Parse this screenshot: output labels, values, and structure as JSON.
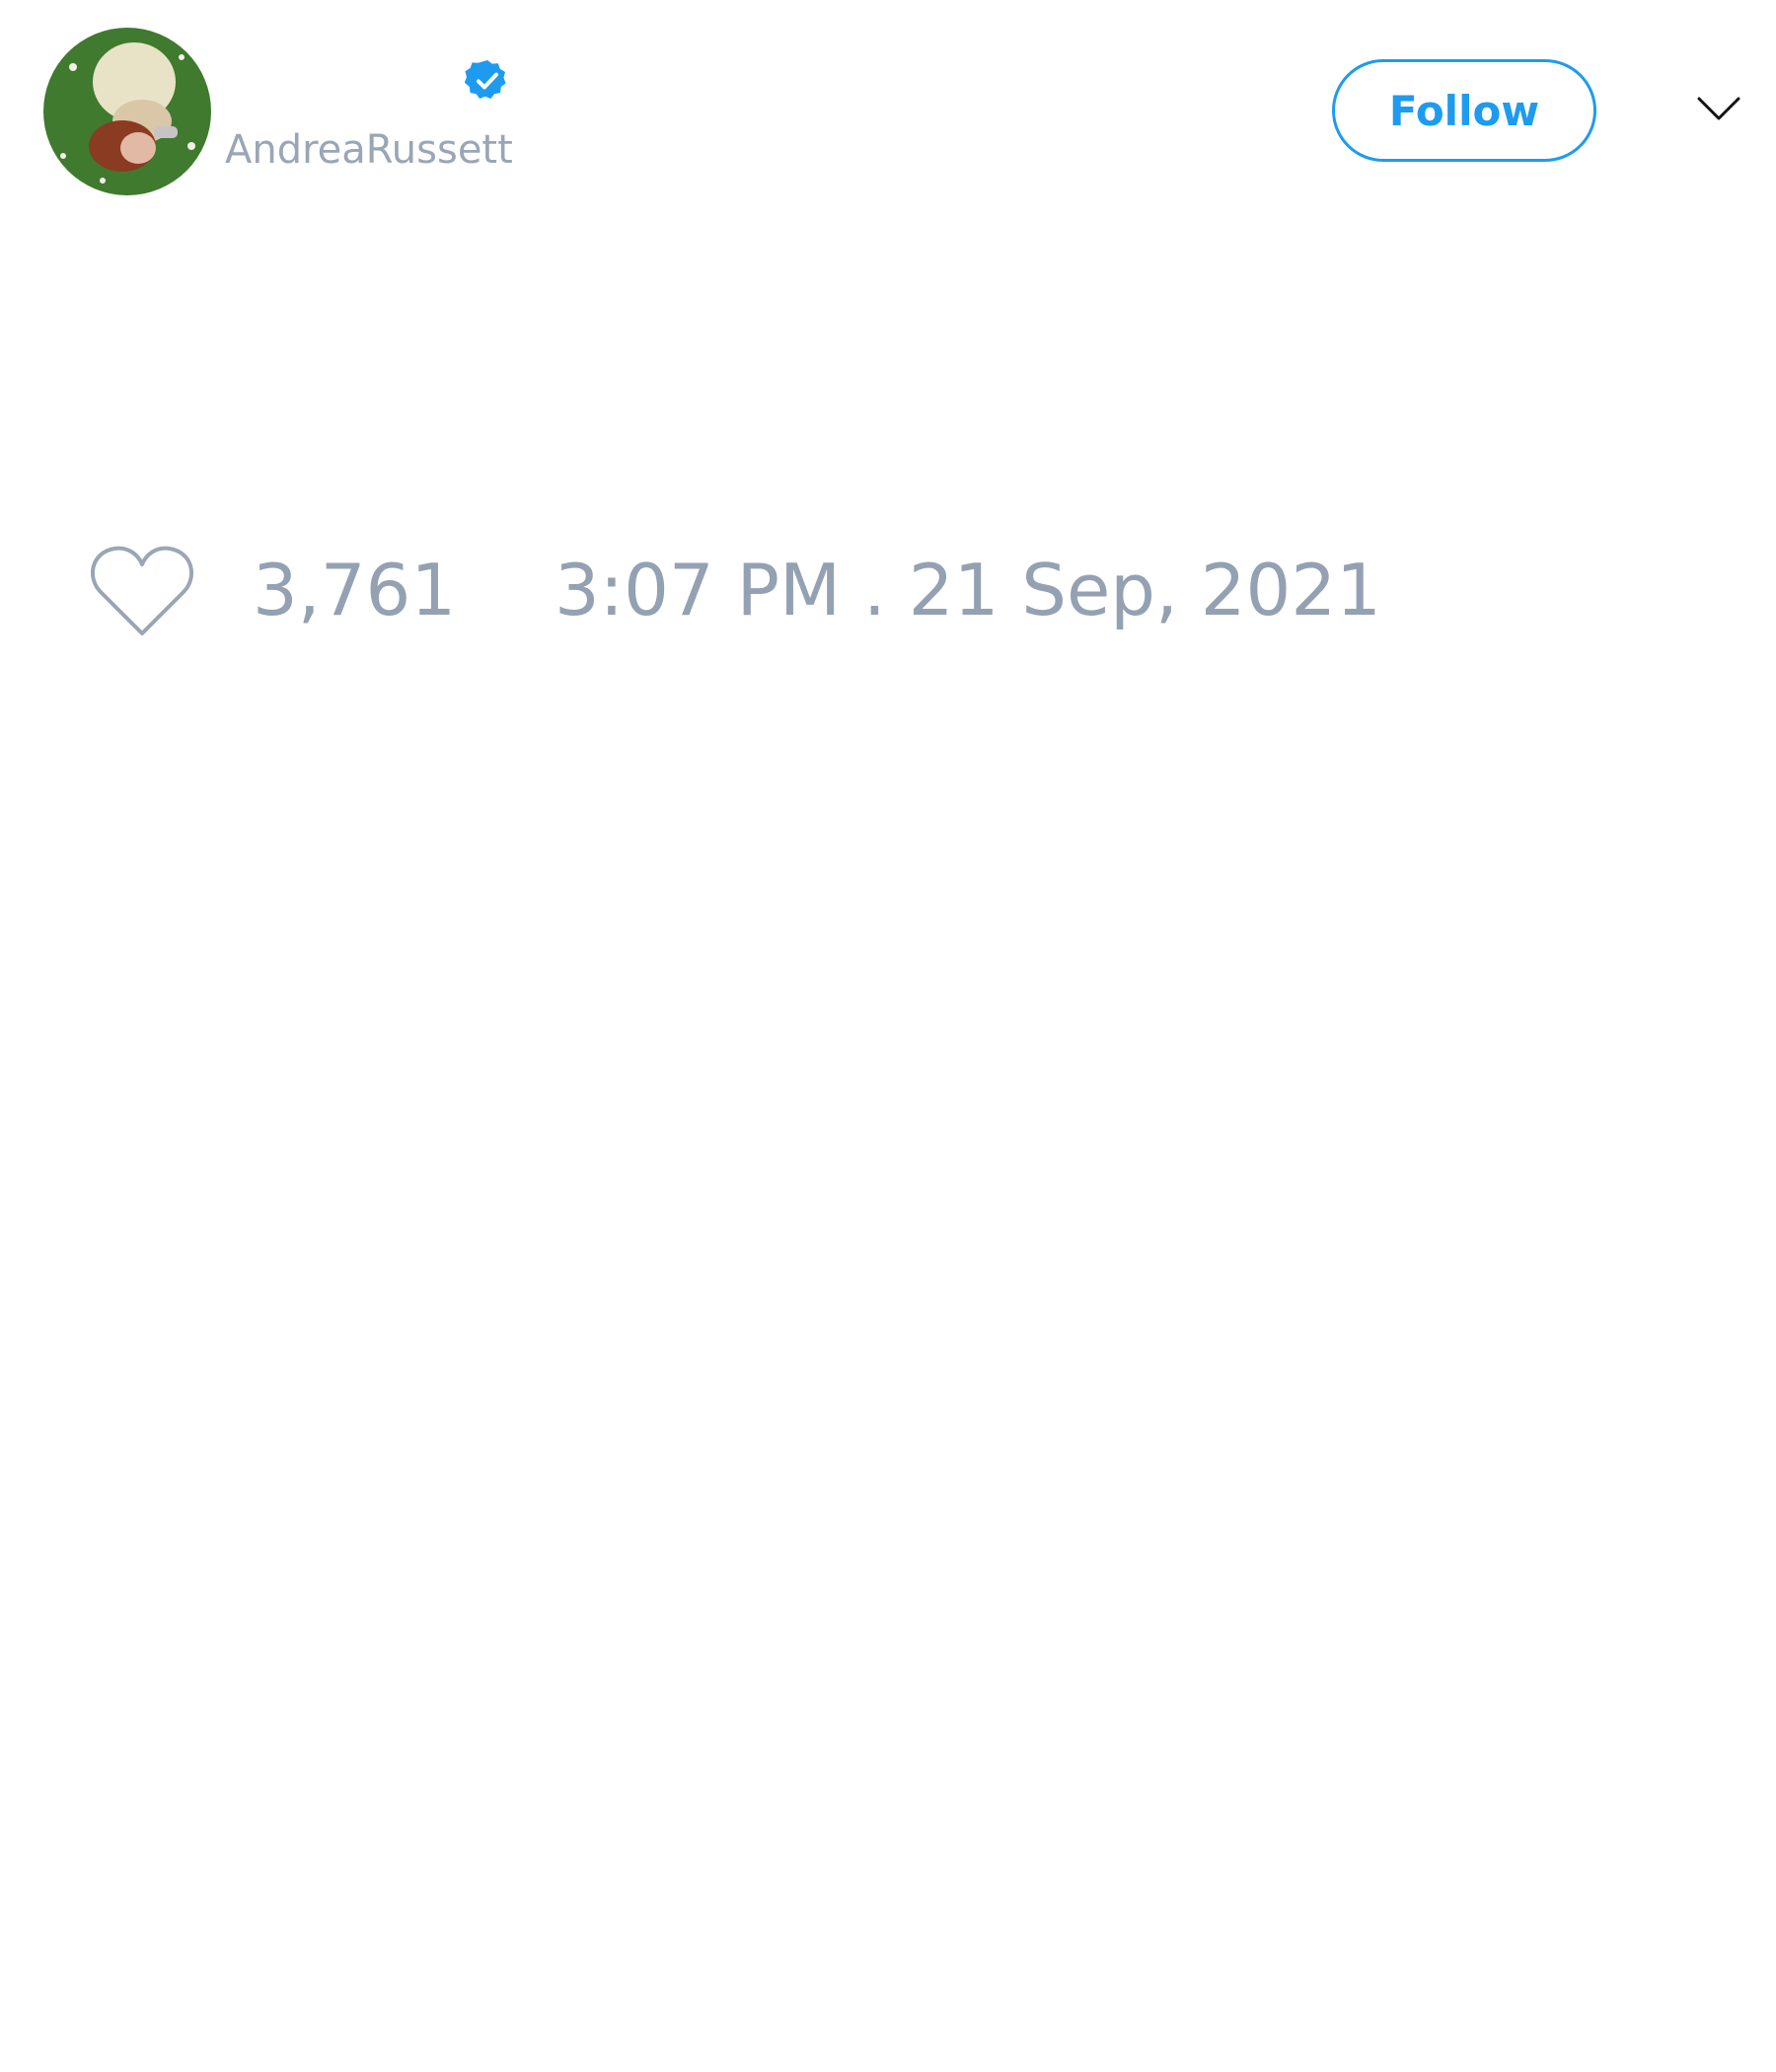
{
  "tweet": {
    "author": {
      "handle": "AndreaRussett",
      "avatar": "profile-photo",
      "verified_icon": "verified-badge-icon"
    },
    "follow_label": "Follow",
    "menu_icon": "chevron-down-icon",
    "likes": {
      "icon": "heart-icon",
      "count": "3,761"
    },
    "timestamp": "3:07 PM . 21 Sep, 2021"
  },
  "colors": {
    "accent": "#1d9bf0",
    "muted_text": "#93a1b3",
    "handle_text": "#9aa6b6",
    "background": "#ffffff"
  }
}
